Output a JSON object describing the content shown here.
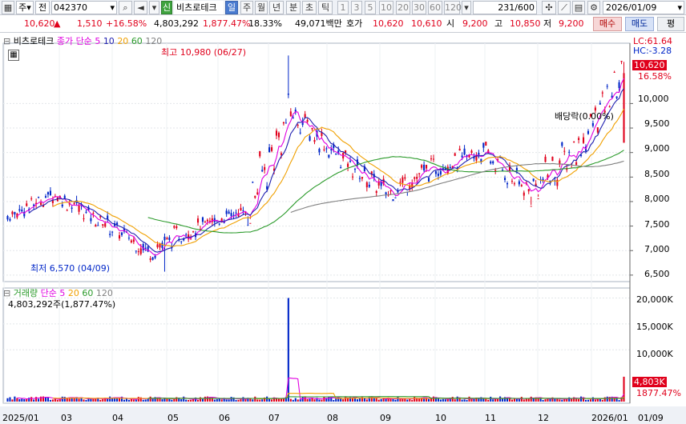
{
  "toolbar": {
    "type_label": "주",
    "jeon_label": "전",
    "code": "042370",
    "info_badge": "신",
    "name": "비츠로테크",
    "periods": [
      "일",
      "주",
      "월",
      "년",
      "분",
      "초",
      "틱"
    ],
    "minutes": [
      "1",
      "3",
      "5",
      "10",
      "20",
      "30",
      "60",
      "120"
    ],
    "count": "231",
    "count_total": "/600",
    "date": "2026/01/09"
  },
  "quote": {
    "price": "10,620",
    "change": "1,510",
    "rate": "+16.58%",
    "volume": "4,803,292",
    "volume_rate": "1,877.47%",
    "turnover": "18.33%",
    "amount": "49,071백만",
    "ask_label": "호가",
    "ask": "10,620",
    "bid": "10,610",
    "open_label": "시",
    "open": "9,200",
    "high_label": "고",
    "high": "10,850",
    "low_label": "저",
    "low": "9,200",
    "buy_label": "매수",
    "sell_label": "매도",
    "eval_label": "평"
  },
  "price_header": {
    "name": "비츠로테크",
    "ma_label": "종가 단순",
    "ma": [
      "5",
      "10",
      "20",
      "60",
      "120"
    ],
    "lc": "LC:61.64",
    "hc": "HC:-3.28"
  },
  "volume_header": {
    "name": "거래량",
    "ma_label": "단순",
    "ma": [
      "5",
      "20",
      "60",
      "120"
    ],
    "current": "4,803,292주(1,877.47%)"
  },
  "annotations": {
    "high": "최고 10,980 (06/27)",
    "low": "최저 6,570 (04/09)",
    "dividend": "배당락(0.00%)"
  },
  "price_axis": {
    "labels": [
      "10,000",
      "9,500",
      "9,000",
      "8,500",
      "8,000",
      "7,500",
      "7,000",
      "6,500"
    ],
    "current": "10,620",
    "current_rate": "16.58%"
  },
  "volume_axis": {
    "labels": [
      "20,000K",
      "15,000K",
      "10,000K"
    ],
    "current": "4,803K",
    "current_rate": "1877.47%"
  },
  "x_axis": {
    "labels": [
      "2025/01",
      "03",
      "04",
      "05",
      "06",
      "07",
      "08",
      "09",
      "10",
      "11",
      "12",
      "2026/01",
      "01/09"
    ]
  },
  "colors": {
    "up": "#e0001b",
    "down": "#0026c8",
    "ma5": "#e000e0",
    "ma10": "#1f1fb0",
    "ma20": "#f0a000",
    "ma60": "#2a9a2a",
    "ma120": "#808080"
  },
  "chart_data": {
    "type": "candlestick",
    "price_range": [
      6400,
      11100
    ],
    "volume_range": [
      0,
      21000
    ],
    "ohlc_monthly": [
      {
        "x": "2025/01",
        "open": 7700,
        "high": 8350,
        "low": 7500,
        "close": 8150
      },
      {
        "x": "02",
        "open": 8150,
        "high": 8400,
        "low": 7500,
        "close": 7600
      },
      {
        "x": "03",
        "open": 7600,
        "high": 7800,
        "low": 6900,
        "close": 7000
      },
      {
        "x": "04",
        "open": 7000,
        "high": 7600,
        "low": 6570,
        "close": 7500
      },
      {
        "x": "05",
        "open": 7500,
        "high": 8000,
        "low": 7400,
        "close": 7800
      },
      {
        "x": "06",
        "open": 7800,
        "high": 10980,
        "low": 7700,
        "close": 9800
      },
      {
        "x": "07",
        "open": 9800,
        "high": 10000,
        "low": 8700,
        "close": 8900
      },
      {
        "x": "08",
        "open": 8900,
        "high": 9000,
        "low": 7900,
        "close": 8200
      },
      {
        "x": "09",
        "open": 8200,
        "high": 9200,
        "low": 8100,
        "close": 8700
      },
      {
        "x": "10",
        "open": 8700,
        "high": 9300,
        "low": 8400,
        "close": 9000
      },
      {
        "x": "11",
        "open": 9000,
        "high": 9100,
        "low": 7800,
        "close": 8200
      },
      {
        "x": "12",
        "open": 8200,
        "high": 10300,
        "low": 8100,
        "close": 9100
      },
      {
        "x": "2026/01",
        "open": 9100,
        "high": 10850,
        "low": 8900,
        "close": 10620
      }
    ],
    "volume_peaks_k": [
      {
        "x": "06",
        "value": 20000
      },
      {
        "x": "2026/01",
        "value": 4803
      }
    ]
  }
}
